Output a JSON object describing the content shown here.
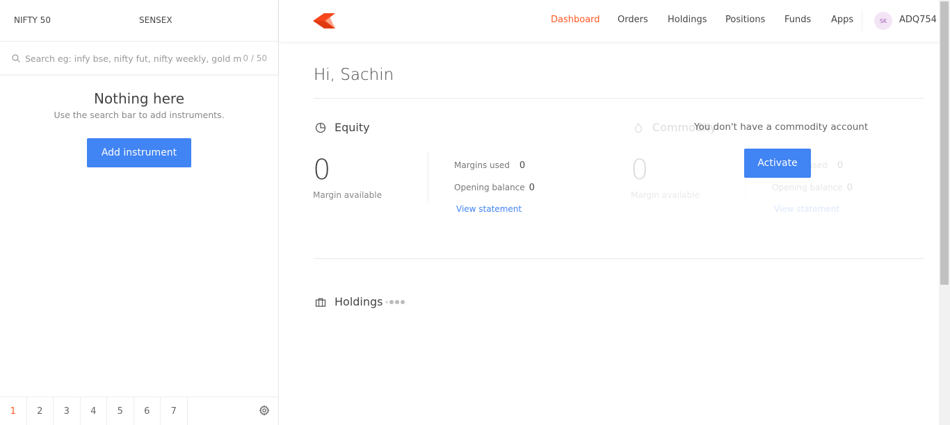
{
  "watchlist": {
    "indices": [
      "NIFTY 50",
      "SENSEX"
    ],
    "search_placeholder": "Search eg: infy bse, nifty fut, nifty weekly, gold mcx",
    "count": "0 / 50",
    "empty_title": "Nothing here",
    "empty_sub": "Use the search bar to add instruments.",
    "add_button": "Add instrument",
    "tabs": [
      "1",
      "2",
      "3",
      "4",
      "5",
      "6",
      "7"
    ],
    "active_tab": "1"
  },
  "nav": {
    "items": [
      "Dashboard",
      "Orders",
      "Holdings",
      "Positions",
      "Funds",
      "Apps"
    ],
    "active": "Dashboard",
    "avatar_initials": "SK",
    "user_id": "ADQ754"
  },
  "dashboard": {
    "greeting": "Hi, Sachin",
    "equity": {
      "title": "Equity",
      "margin_available_value": "0",
      "margin_available_label": "Margin available",
      "margins_used_label": "Margins used",
      "margins_used_value": "0",
      "opening_balance_label": "Opening balance",
      "opening_balance_value": "0",
      "view_statement": "View statement"
    },
    "commodity": {
      "title": "Commodity",
      "margin_available_value": "0",
      "margin_available_label": "Margin available",
      "margins_used_label": "Margins used",
      "margins_used_value": "0",
      "opening_balance_label": "Opening balance",
      "opening_balance_value": "0",
      "view_statement": "View statement",
      "message": "You don't have a commodity account",
      "activate_button": "Activate"
    },
    "holdings_title": "Holdings"
  },
  "colors": {
    "accent": "#ff5722",
    "primary_button": "#4184f3"
  }
}
